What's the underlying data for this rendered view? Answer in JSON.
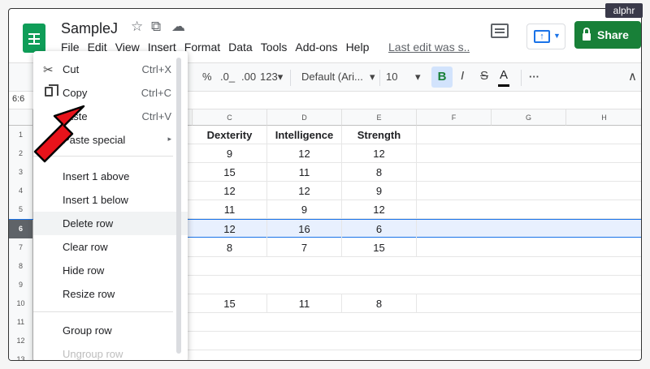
{
  "app": {
    "title": "SampleJ",
    "menu": [
      "File",
      "Edit",
      "View",
      "Insert",
      "Format",
      "Data",
      "Tools",
      "Add-ons",
      "Help"
    ],
    "last_edit": "Last edit was s...",
    "share_label": "Share",
    "title_icons": [
      "star-icon",
      "move-to-drive-icon",
      "cloud-status-icon"
    ],
    "brand_color": "#188038",
    "watermark": "alphr"
  },
  "toolbar": {
    "percent": "%",
    "decimal_less": ".0_",
    "decimal_more": ".00",
    "number_format": "123",
    "font": "Default (Ari...",
    "size": "10",
    "bold": "B",
    "italic": "I",
    "strike": "S",
    "text_color": "A",
    "more": "···",
    "dropdown": "▾",
    "collapse": "∧",
    "partial": "s"
  },
  "formula_bar": {
    "name_box": "6:6"
  },
  "grid": {
    "columns": [
      "C",
      "D",
      "E",
      "F",
      "G",
      "H"
    ],
    "rows": [
      {
        "num": "1",
        "c": "Dexterity",
        "d": "Intelligence",
        "e": "Strength"
      },
      {
        "num": "2",
        "c": "9",
        "d": "12",
        "e": "12"
      },
      {
        "num": "3",
        "c": "15",
        "d": "11",
        "e": "8"
      },
      {
        "num": "4",
        "c": "12",
        "d": "12",
        "e": "9"
      },
      {
        "num": "5",
        "c": "11",
        "d": "9",
        "e": "12"
      },
      {
        "num": "6",
        "c": "12",
        "d": "16",
        "e": "6"
      },
      {
        "num": "7",
        "c": "8",
        "d": "7",
        "e": "15"
      },
      {
        "num": "8",
        "c": "",
        "d": "",
        "e": ""
      },
      {
        "num": "9",
        "c": "",
        "d": "",
        "e": ""
      },
      {
        "num": "10",
        "c": "15",
        "d": "11",
        "e": "8"
      },
      {
        "num": "11",
        "c": "",
        "d": "",
        "e": ""
      },
      {
        "num": "12",
        "c": "",
        "d": "",
        "e": ""
      },
      {
        "num": "13",
        "c": "",
        "d": "",
        "e": ""
      }
    ]
  },
  "context_menu": {
    "cut": {
      "label": "Cut",
      "shortcut": "Ctrl+X"
    },
    "copy": {
      "label": "Copy",
      "shortcut": "Ctrl+C"
    },
    "paste": {
      "label": "aste",
      "shortcut": "Ctrl+V"
    },
    "paste_special": {
      "label": "Paste special",
      "arrow": "▸"
    },
    "insert_above": "Insert 1 above",
    "insert_below": "Insert 1 below",
    "delete_row": "Delete row",
    "clear_row": "Clear row",
    "hide_row": "Hide row",
    "resize_row": "Resize row",
    "group_row": "Group row",
    "ungroup_row": "Ungroup row"
  },
  "annotation": {
    "arrow_color": "#e8131b"
  }
}
